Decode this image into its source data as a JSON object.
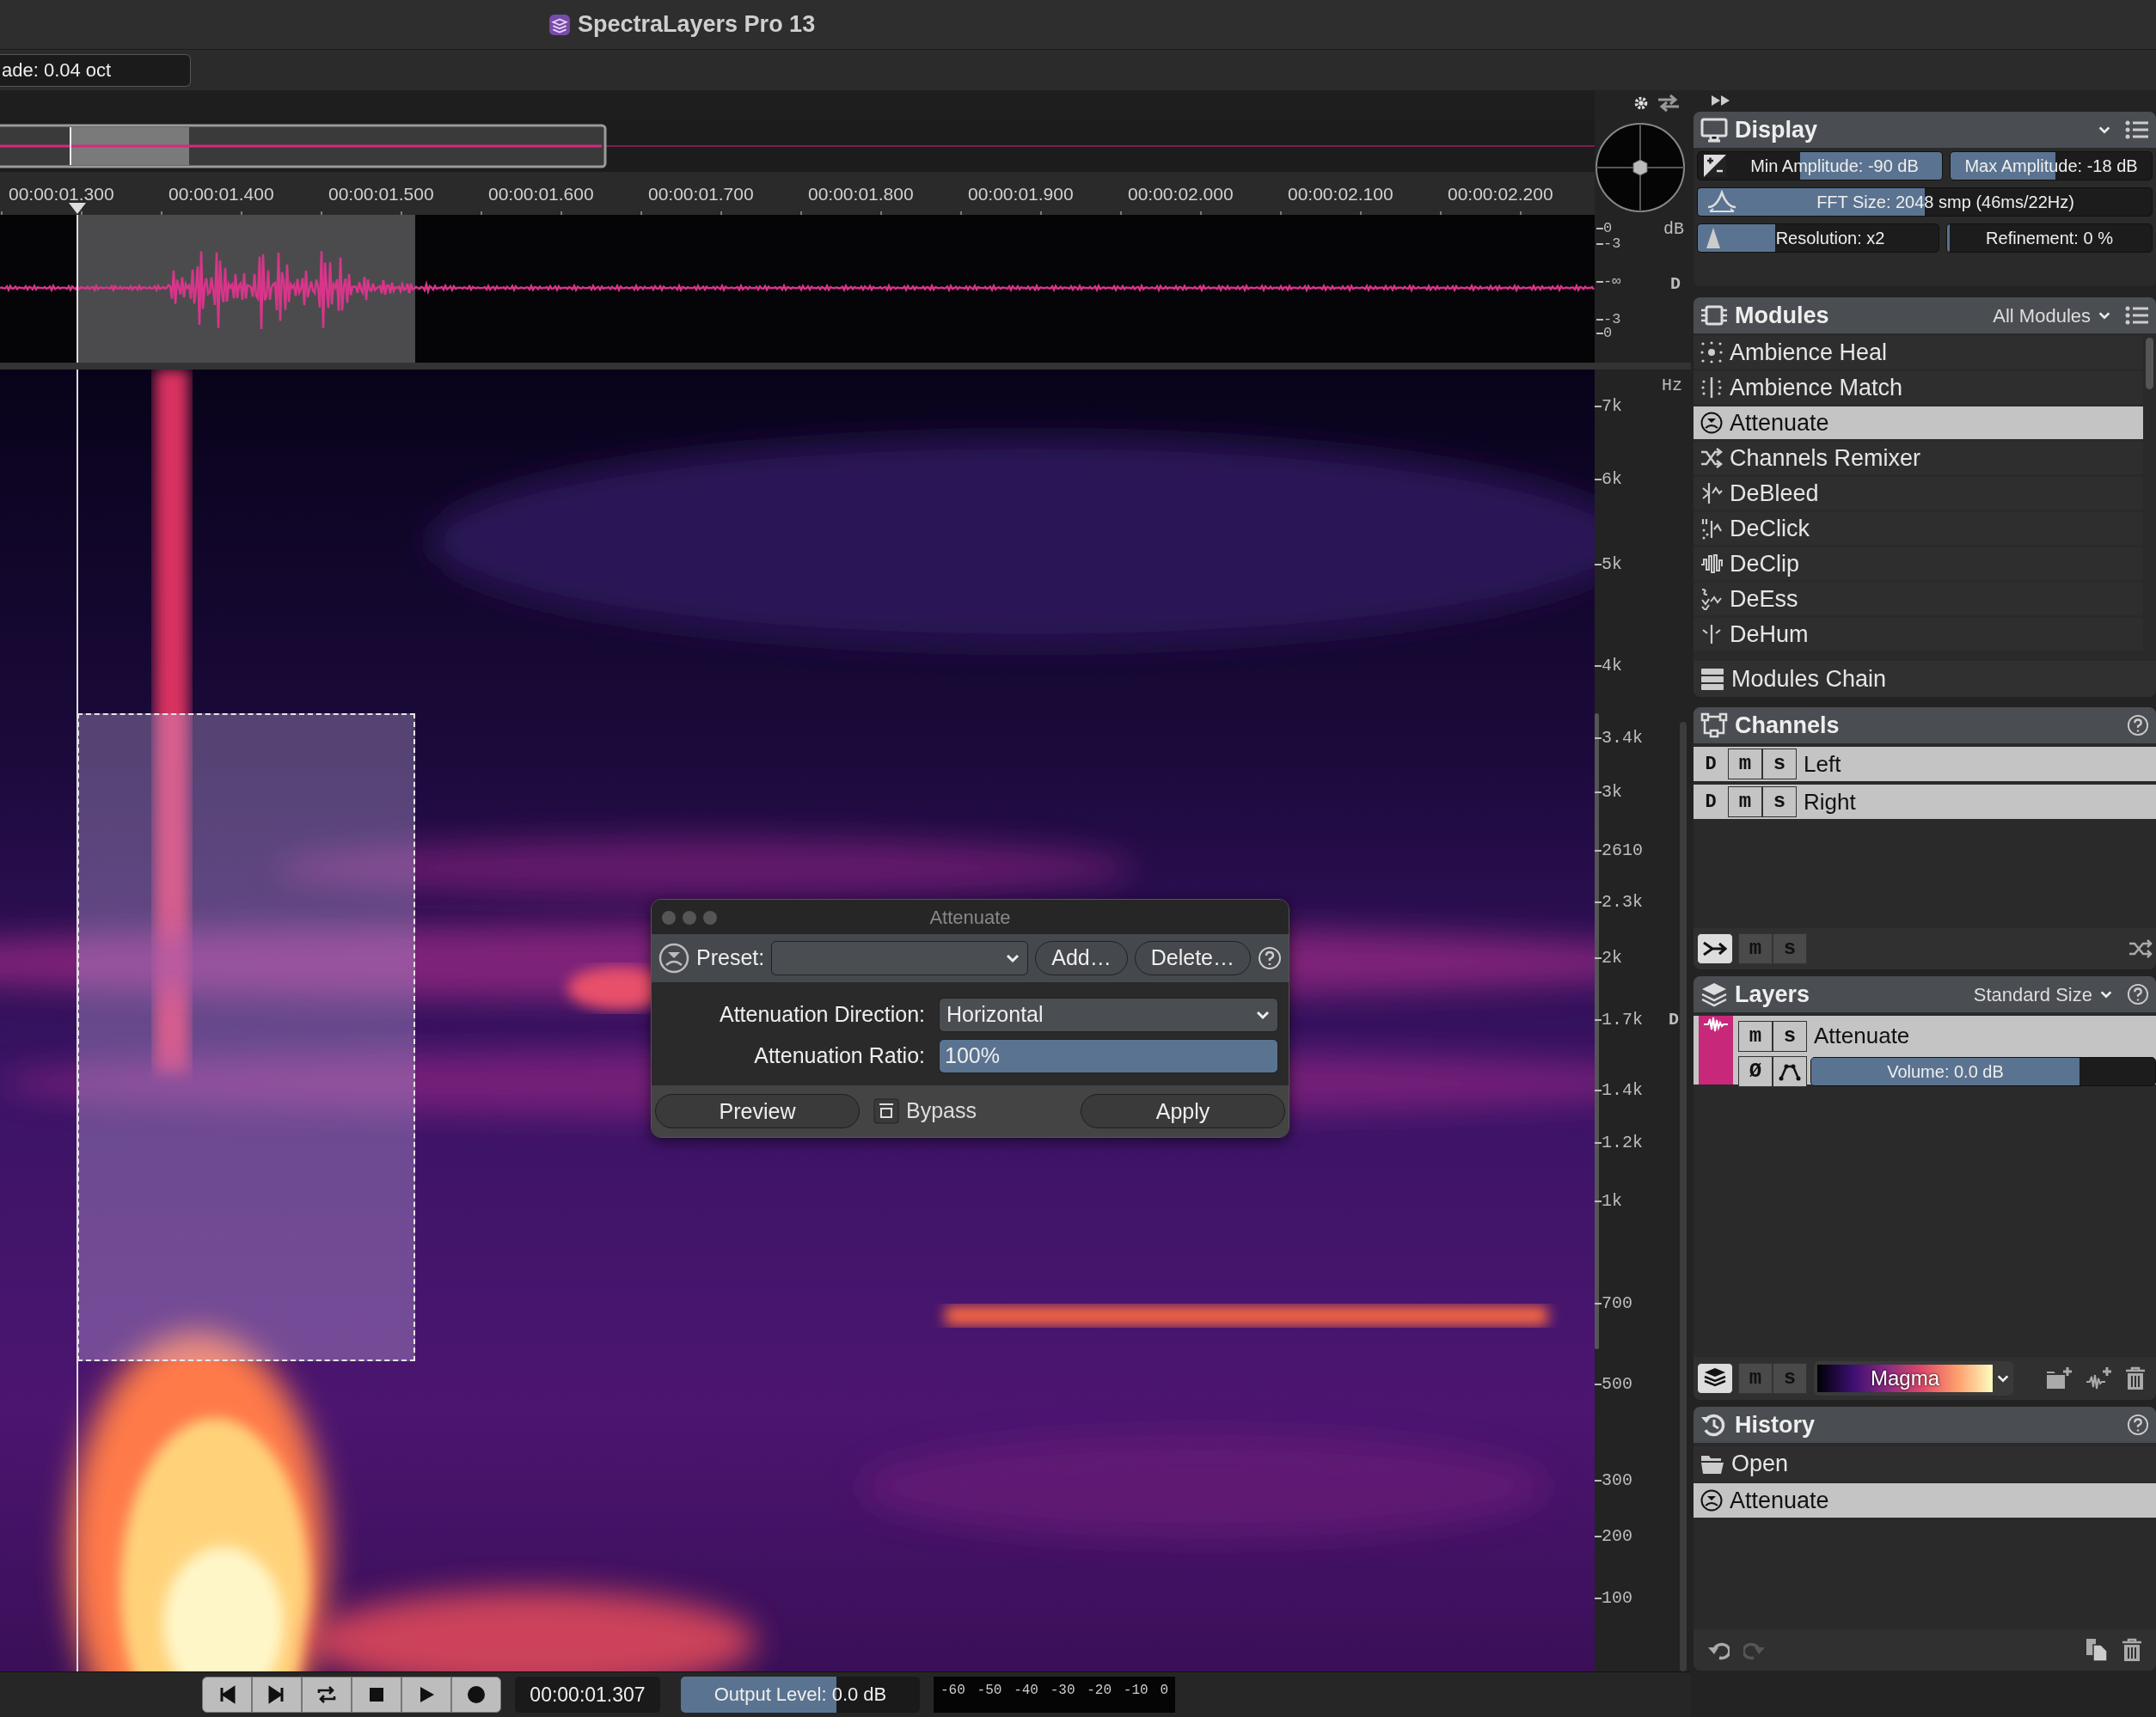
{
  "window": {
    "title": "SpectraLayers Pro 13"
  },
  "toolbar": {
    "field": "ade: 0.04 oct"
  },
  "timeline": {
    "ruler": [
      "00:00:01.300",
      "00:00:01.400",
      "00:00:01.500",
      "00:00:01.600",
      "00:00:01.700",
      "00:00:01.800",
      "00:00:01.900",
      "00:00:02.000",
      "00:00:02.100",
      "00:00:02.200"
    ]
  },
  "waveform_axis": {
    "unit": "dB",
    "ticks": [
      "0",
      "-3",
      "-∞",
      "-3",
      "0"
    ],
    "marker": "D"
  },
  "frequency_axis": {
    "unit": "Hz",
    "ticks": [
      {
        "label": "7k"
      },
      {
        "label": "6k"
      },
      {
        "label": "5k"
      },
      {
        "label": "4k"
      },
      {
        "label": "3.4k"
      },
      {
        "label": "3k"
      },
      {
        "label": "2610"
      },
      {
        "label": "2.3k"
      },
      {
        "label": "2k"
      },
      {
        "label": "1.7k",
        "marker": "D"
      },
      {
        "label": "1.4k"
      },
      {
        "label": "1.2k"
      },
      {
        "label": "1k"
      },
      {
        "label": "700"
      },
      {
        "label": "500"
      },
      {
        "label": "300"
      },
      {
        "label": "200"
      },
      {
        "label": "100"
      }
    ]
  },
  "dialog": {
    "title": "Attenuate",
    "preset_label": "Preset:",
    "preset_buttons": [
      "Add…",
      "Delete…"
    ],
    "fields": [
      {
        "kind": "dropdown",
        "label": "Attenuation Direction:",
        "value": "Horizontal"
      },
      {
        "kind": "slider",
        "label": "Attenuation Ratio:",
        "value": "100%",
        "level": 1
      }
    ],
    "preview": "Preview",
    "bypass": {
      "label": "Bypass",
      "checked": false
    },
    "apply": "Apply"
  },
  "transport": {
    "time": "00:00:01.307",
    "output_level": {
      "label": "Output Level:",
      "value": "0.0 dB",
      "level": 0.65
    },
    "meter_ticks": [
      "-60",
      "-50",
      "-40",
      "-30",
      "-20",
      "-10",
      "0"
    ]
  },
  "display": {
    "title": "Display",
    "min_amplitude": {
      "text": "Min Amplitude: -90 dB",
      "level": 0.58
    },
    "max_amplitude": {
      "text": "Max Amplitude: -18 dB",
      "level": 0.52
    },
    "fft_size": {
      "text": "FFT Size: 2048 smp (46ms/22Hz)",
      "level": 0.5
    },
    "resolution": {
      "text": "Resolution: x2",
      "level": 0.32
    },
    "refinement": {
      "text": "Refinement: 0 %",
      "level": 0
    }
  },
  "modules": {
    "title": "Modules",
    "filter": "All Modules",
    "items": [
      {
        "label": "Ambience Heal",
        "selected": false
      },
      {
        "label": "Ambience Match",
        "selected": false
      },
      {
        "label": "Attenuate",
        "selected": true
      },
      {
        "label": "Channels Remixer",
        "selected": false
      },
      {
        "label": "DeBleed",
        "selected": false
      },
      {
        "label": "DeClick",
        "selected": false
      },
      {
        "label": "DeClip",
        "selected": false
      },
      {
        "label": "DeEss",
        "selected": false
      },
      {
        "label": "DeHum",
        "selected": false
      }
    ],
    "footer": "Modules Chain"
  },
  "channels": {
    "title": "Channels",
    "items": [
      {
        "name": "Left",
        "d": "D",
        "mute": "m",
        "solo": "s"
      },
      {
        "name": "Right",
        "d": "D",
        "mute": "m",
        "solo": "s"
      }
    ],
    "footer_buttons": [
      "m",
      "s"
    ]
  },
  "layers": {
    "title": "Layers",
    "size_filter": "Standard Size",
    "items": [
      {
        "name": "Attenuate",
        "color": "#c8287a",
        "mute": "m",
        "solo": "s",
        "phase": "Ø",
        "volume": "Volume: 0.0 dB",
        "level": 0.78
      }
    ],
    "footer_buttons": [
      "m",
      "s"
    ],
    "colormap": "Magma"
  },
  "history": {
    "title": "History",
    "items": [
      {
        "label": "Open",
        "selected": false,
        "kind": "open"
      },
      {
        "label": "Attenuate",
        "selected": true,
        "kind": "module"
      }
    ]
  }
}
